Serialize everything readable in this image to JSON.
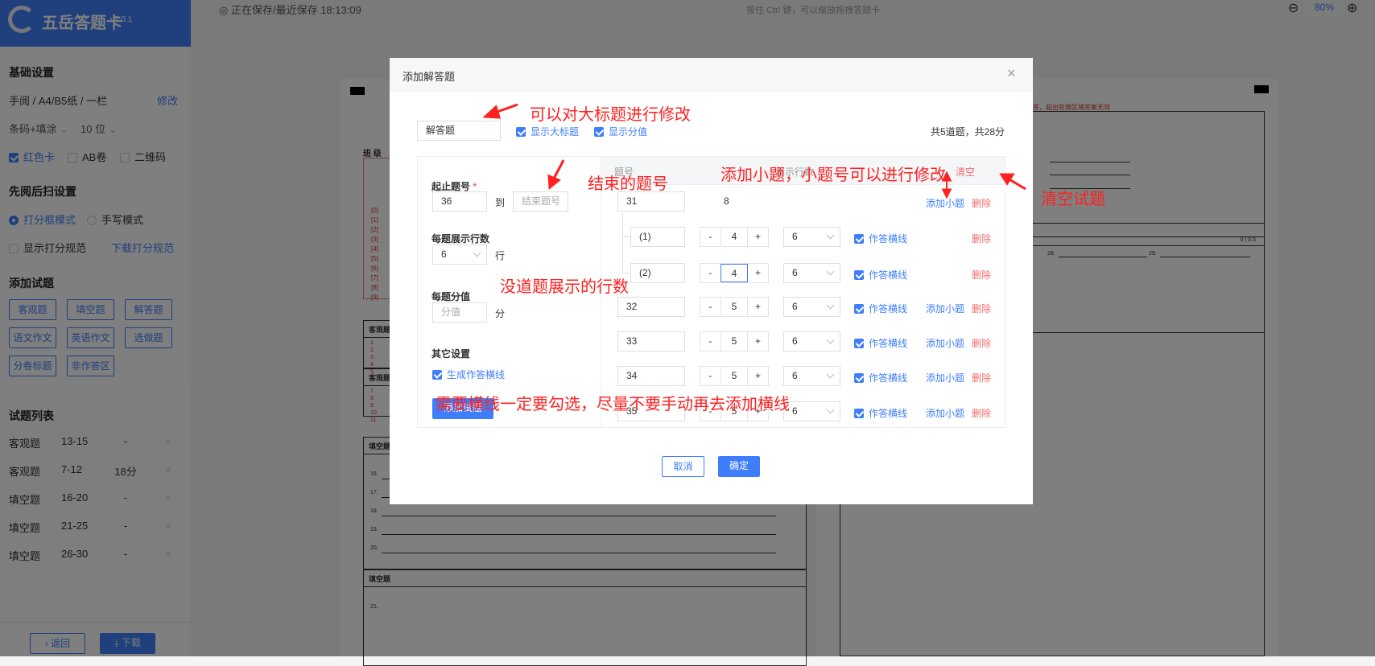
{
  "app": {
    "name": "五岳答题卡",
    "version": "v2.0.1"
  },
  "topbar": {
    "save_status": "正在保存/最近保存 18:13:09",
    "hint": "按住 Ctrl 键，可以缩放拖拽答题卡",
    "zoom": "80%"
  },
  "sidebar": {
    "basic_title": "基础设置",
    "layout": "手阅 / A4/B5纸 / 一栏",
    "edit": "修改",
    "barcode": "条码+填涂",
    "digits": "10 位",
    "options": [
      {
        "label": "红色卡",
        "checked": true
      },
      {
        "label": "AB卷",
        "checked": false
      },
      {
        "label": "二维码",
        "checked": false
      }
    ],
    "scan_title": "先阅后扫设置",
    "modes": [
      {
        "label": "打分框模式",
        "selected": true
      },
      {
        "label": "手写模式",
        "selected": false
      }
    ],
    "show_spec": "显示打分规范",
    "download_spec": "下载打分规范",
    "add_title": "添加试题",
    "add_buttons": [
      "客观题",
      "填空题",
      "解答题",
      "语文作文",
      "英语作文",
      "选做题",
      "分卷标题",
      "非作答区"
    ],
    "list_title": "试题列表",
    "list": [
      {
        "type": "客观题",
        "range": "13-15",
        "score": "-"
      },
      {
        "type": "客观题",
        "range": "7-12",
        "score": "18分"
      },
      {
        "type": "填空题",
        "range": "16-20",
        "score": "-"
      },
      {
        "type": "填空题",
        "range": "21-25",
        "score": "-"
      },
      {
        "type": "填空题",
        "range": "26-30",
        "score": "-"
      }
    ],
    "back": "返回",
    "download": "下载"
  },
  "paper": {
    "class_label": "班 级",
    "bubbles": [
      "[0]",
      "[1]",
      "[2]",
      "[3]",
      "[4]",
      "[5]",
      "[6]",
      "[7]",
      "[8]",
      "[9]"
    ],
    "sections": [
      "客观题",
      "客观题",
      "填空题",
      "填空题"
    ],
    "objective_a": [
      "1.",
      "2.",
      "3.",
      "4.",
      "5."
    ],
    "objective_b": [
      "7.",
      "8.",
      "9.",
      "10.",
      "11."
    ],
    "blanks": [
      "16.",
      "17.",
      "18.",
      "19.",
      "20."
    ],
    "next_blank": "21.",
    "score_cells": [
      "0",
      "0.5"
    ],
    "right_notice": "答，超出答题区域答案无效",
    "right_blanks": [
      "28.",
      "29."
    ]
  },
  "modal": {
    "title": "添加解答题",
    "title_value": "解答题",
    "show_title": "显示大标题",
    "show_score": "显示分值",
    "summary": "共5道题，共28分",
    "form": {
      "range_label": "起止题号",
      "required": "*",
      "start": "36",
      "to": "到",
      "end_placeholder": "结束题号",
      "rows_label": "每题展示行数",
      "rows_value": "6",
      "rows_unit": "行",
      "score_label": "每题分值",
      "score_placeholder": "分值",
      "score_unit": "分",
      "other_label": "其它设置",
      "lines_label": "生成作答横线",
      "add_button": "添加试题"
    },
    "table": {
      "header_no": "题号",
      "header_rows": "展示行数",
      "clear": "清空",
      "rows": [
        {
          "no": "31",
          "score": "8",
          "parent": true,
          "add": "添加小题",
          "del": "删除"
        },
        {
          "no": "(1)",
          "score": "4",
          "rows": "6",
          "line": "作答横线",
          "checked": true,
          "sub": true,
          "del": "删除"
        },
        {
          "no": "(2)",
          "score": "4",
          "rows": "6",
          "line": "作答横线",
          "checked": true,
          "sub": true,
          "focus": true,
          "del": "删除"
        },
        {
          "no": "32",
          "score": "5",
          "rows": "6",
          "line": "作答横线",
          "checked": true,
          "add": "添加小题",
          "del": "删除"
        },
        {
          "no": "33",
          "score": "5",
          "rows": "6",
          "line": "作答横线",
          "checked": true,
          "add": "添加小题",
          "del": "删除"
        },
        {
          "no": "34",
          "score": "5",
          "rows": "6",
          "line": "作答横线",
          "checked": true,
          "add": "添加小题",
          "del": "删除"
        },
        {
          "no": "35",
          "score": "5",
          "rows": "6",
          "line": "作答横线",
          "checked": true,
          "add": "添加小题",
          "del": "删除"
        }
      ]
    },
    "cancel": "取消",
    "confirm": "确定"
  },
  "annotations": {
    "title_edit": "可以对大标题进行修改",
    "end_no": "结束的题号",
    "add_sub": "添加小题，小题号可以进行修改",
    "clear": "清空试题",
    "rows_per": "没道题展示的行数",
    "lines_tip": "需要横线一定要勾选，尽量不要手动再去添加横线"
  },
  "colors": {
    "accent": "#3e7efa",
    "danger": "#f56c6c",
    "annotation": "#ff2020"
  }
}
